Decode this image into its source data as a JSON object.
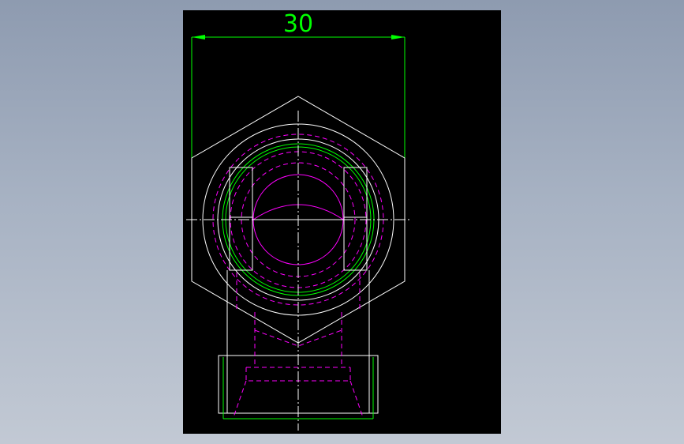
{
  "drawing": {
    "dimension_label": "30",
    "colors": {
      "background_outer": "#a7b2c3",
      "canvas": "#000000",
      "outline": "#ffffff",
      "hidden_lines": "#ff00ff",
      "dimension": "#00ff00",
      "centerline": "#ffffff"
    }
  }
}
